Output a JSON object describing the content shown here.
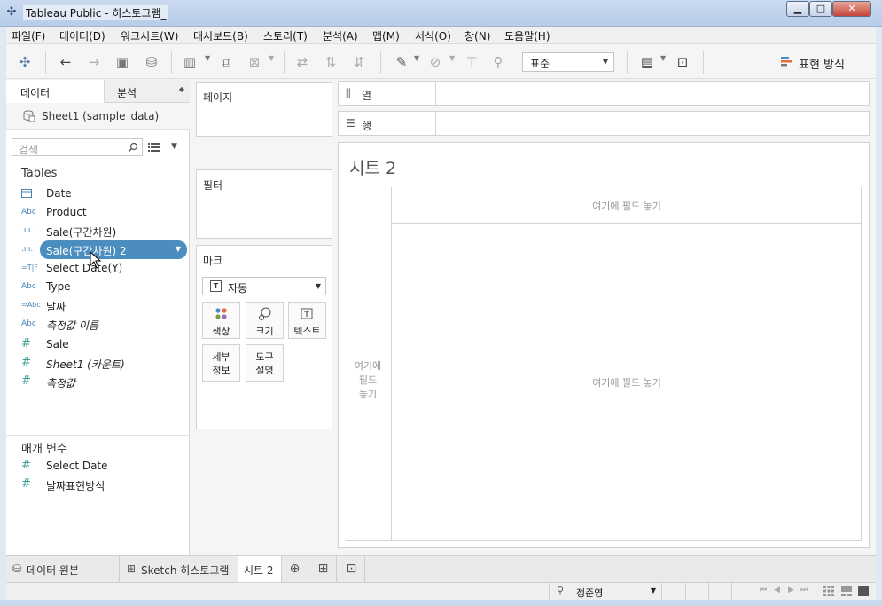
{
  "window": {
    "title": "Tableau Public - 히스토그램_"
  },
  "menu": [
    "파일(F)",
    "데이터(D)",
    "워크시트(W)",
    "대시보드(B)",
    "스토리(T)",
    "분석(A)",
    "맵(M)",
    "서식(O)",
    "창(N)",
    "도움말(H)"
  ],
  "toolbar": {
    "fit": "표준",
    "show_me": "표현 방식"
  },
  "data_pane": {
    "tabs": {
      "data": "데이터",
      "analysis": "분석"
    },
    "datasource": "Sheet1 (sample_data)",
    "search_placeholder": "검색",
    "tables_title": "Tables",
    "dimensions": [
      {
        "type": "Date",
        "type_icon": "calendar-icon",
        "name": "Date"
      },
      {
        "type": "Abc",
        "name": "Product"
      },
      {
        "type": ".ılı.",
        "name": "Sale(구간차원)"
      },
      {
        "type": ".ılı.",
        "name": "Sale(구간차원) 2",
        "selected": true
      },
      {
        "type": "=T|F",
        "name": "Select Date(Y)"
      },
      {
        "type": "Abc",
        "name": "Type"
      },
      {
        "type": "=Abc",
        "name": "날짜"
      },
      {
        "type": "Abc",
        "name": "측정값 이름",
        "italic": true
      }
    ],
    "measures": [
      {
        "type": "#",
        "name": "Sale"
      },
      {
        "type": "#",
        "name": "Sheet1 (카운트)",
        "italic": true
      },
      {
        "type": "#",
        "name": "측정값",
        "italic": true
      }
    ],
    "parameters_title": "매개 변수",
    "parameters": [
      {
        "type": "#",
        "name": "Select Date"
      },
      {
        "type": "#",
        "name": "날짜표현방식"
      }
    ]
  },
  "cards": {
    "pages": "페이지",
    "filters": "필터",
    "marks": "마크",
    "marks_type_icon": "T",
    "marks_type": "자동",
    "mark_buttons": {
      "color": "색상",
      "size": "크기",
      "text": "텍스트",
      "detail_1": "세부",
      "detail_2": "정보",
      "tooltip_1": "도구",
      "tooltip_2": "설명"
    }
  },
  "shelves": {
    "columns": "열",
    "rows": "행"
  },
  "canvas": {
    "sheet_title": "시트 2",
    "drop_field_top": "여기에 필드 놓기",
    "drop_field_left_1": "여기에",
    "drop_field_left_2": "필드",
    "drop_field_left_3": "놓기",
    "drop_field_center": "여기에 필드 놓기"
  },
  "tabs": {
    "datasource": "데이터 원본",
    "sheet1": "Sketch 히스토그램",
    "sheet2": "시트 2"
  },
  "status": {
    "user": "정준영"
  },
  "colors": {
    "accent": "#4b8dbf",
    "dimension": "#4a84b5",
    "measure": "#3a9e94"
  }
}
